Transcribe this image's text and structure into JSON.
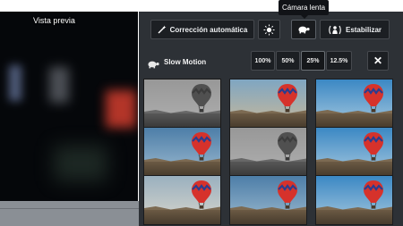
{
  "preview": {
    "label": "Vista previa"
  },
  "tooltip": {
    "text": "Cámara lenta"
  },
  "toolbar": {
    "autofix_label": "Corrección automática",
    "autofix_icon": "magic-wand-icon",
    "brightness_icon": "sun-icon",
    "slowmo_icon": "turtle-icon",
    "stabilize_label": "Estabilizar",
    "stabilize_icon": "stabilize-person-icon"
  },
  "slow_motion": {
    "label": "Slow Motion",
    "icon": "turtle-icon",
    "speeds": [
      "100%",
      "50%",
      "25%",
      "12.5%"
    ],
    "selected_speed": "25%",
    "close_label": "✕"
  },
  "filters": {
    "rows": 3,
    "cols": 3,
    "styles": [
      "gray",
      "warm",
      "sat",
      "cool",
      "gray",
      "sat",
      "fade",
      "cool",
      "sat"
    ]
  },
  "colors": {
    "panel_bg": "#2d3136",
    "button_bg": "#1c1f23",
    "balloon_red": "#d6322b",
    "balloon_gray": "#6a6a6a"
  }
}
